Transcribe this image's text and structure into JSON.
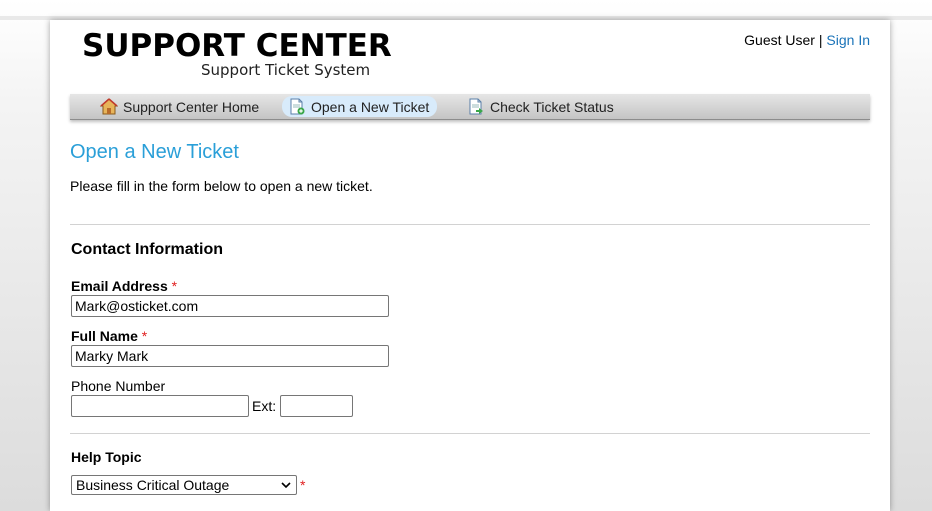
{
  "header": {
    "logo_title": "SUPPORT CENTER",
    "logo_subtitle": "Support Ticket System",
    "user_label": "Guest User",
    "separator": "|",
    "signin_label": "Sign In"
  },
  "nav": {
    "items": [
      {
        "label": "Support Center Home",
        "icon": "home-icon",
        "active": false
      },
      {
        "label": "Open a New Ticket",
        "icon": "new-ticket-icon",
        "active": true
      },
      {
        "label": "Check Ticket Status",
        "icon": "ticket-status-icon",
        "active": false
      }
    ]
  },
  "page": {
    "title": "Open a New Ticket",
    "intro": "Please fill in the form below to open a new ticket."
  },
  "contact": {
    "section_title": "Contact Information",
    "email_label": "Email Address",
    "email_value": "Mark@osticket.com",
    "name_label": "Full Name",
    "name_value": "Marky Mark",
    "phone_label": "Phone Number",
    "phone_value": "",
    "ext_label": "Ext:",
    "ext_value": "",
    "required_mark": "*"
  },
  "help_topic": {
    "section_title": "Help Topic",
    "selected": "Business Critical Outage",
    "required_mark": "*"
  },
  "colors": {
    "accent": "#2a9fd8",
    "link": "#1a73b8",
    "required": "#e02020",
    "active_tab": "#d8ebfb"
  }
}
